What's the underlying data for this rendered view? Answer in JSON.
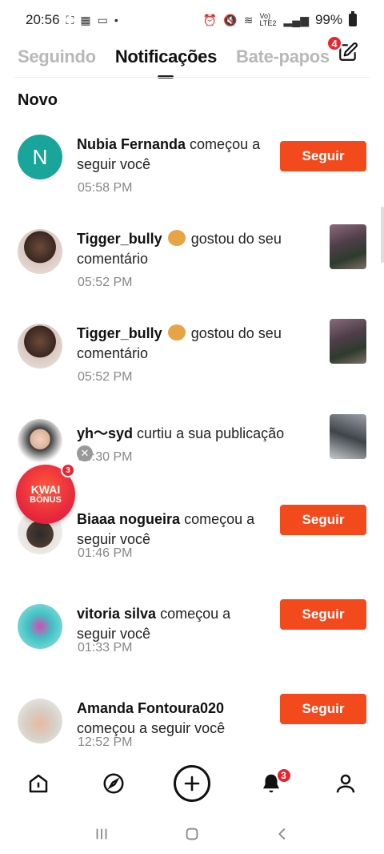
{
  "status_bar": {
    "time": "20:56",
    "network": "Vo) LTE2",
    "battery": "99%"
  },
  "tabs": [
    {
      "label": "Seguindo",
      "active": false
    },
    {
      "label": "Notificações",
      "active": true
    },
    {
      "label": "Bate-papos",
      "active": false,
      "badge": "4"
    }
  ],
  "compose_icon": "compose-edit-icon",
  "section_title": "Novo",
  "notifications": [
    {
      "name": "Nubia Fernanda",
      "action": "começou a seguir você",
      "time": "05:58 PM",
      "avatar_letter": "N",
      "button": "Seguir"
    },
    {
      "name": "Tigger_bully",
      "action": "gostou do seu comentário",
      "time": "05:52 PM"
    },
    {
      "name": "Tigger_bully",
      "action": "gostou do seu comentário",
      "time": "05:52 PM"
    },
    {
      "name": "yh～syd",
      "action": "curtiu a sua publicação",
      "time": "04:30 PM"
    },
    {
      "name": "Biaaa nogueira",
      "action": "começou a seguir você",
      "time": "01:46 PM",
      "button": "Seguir"
    },
    {
      "name": "vitoria silva",
      "action": "começou a seguir você",
      "time": "01:33 PM",
      "button": "Seguir"
    },
    {
      "name": "Amanda Fontoura020",
      "action": "começou a seguir você",
      "time": "12:52 PM",
      "button": "Seguir"
    }
  ],
  "kwai_bonus": {
    "line1": "KWAI",
    "line2": "BÔNUS",
    "badge": "3"
  },
  "bottom_nav": {
    "items": [
      "home-icon",
      "discover-icon",
      "create-icon",
      "notifications-icon",
      "profile-icon"
    ],
    "notifications_badge": "3"
  },
  "colors": {
    "accent": "#f24a1d",
    "badge": "#e8242f",
    "avatar_teal": "#1aa59a"
  }
}
